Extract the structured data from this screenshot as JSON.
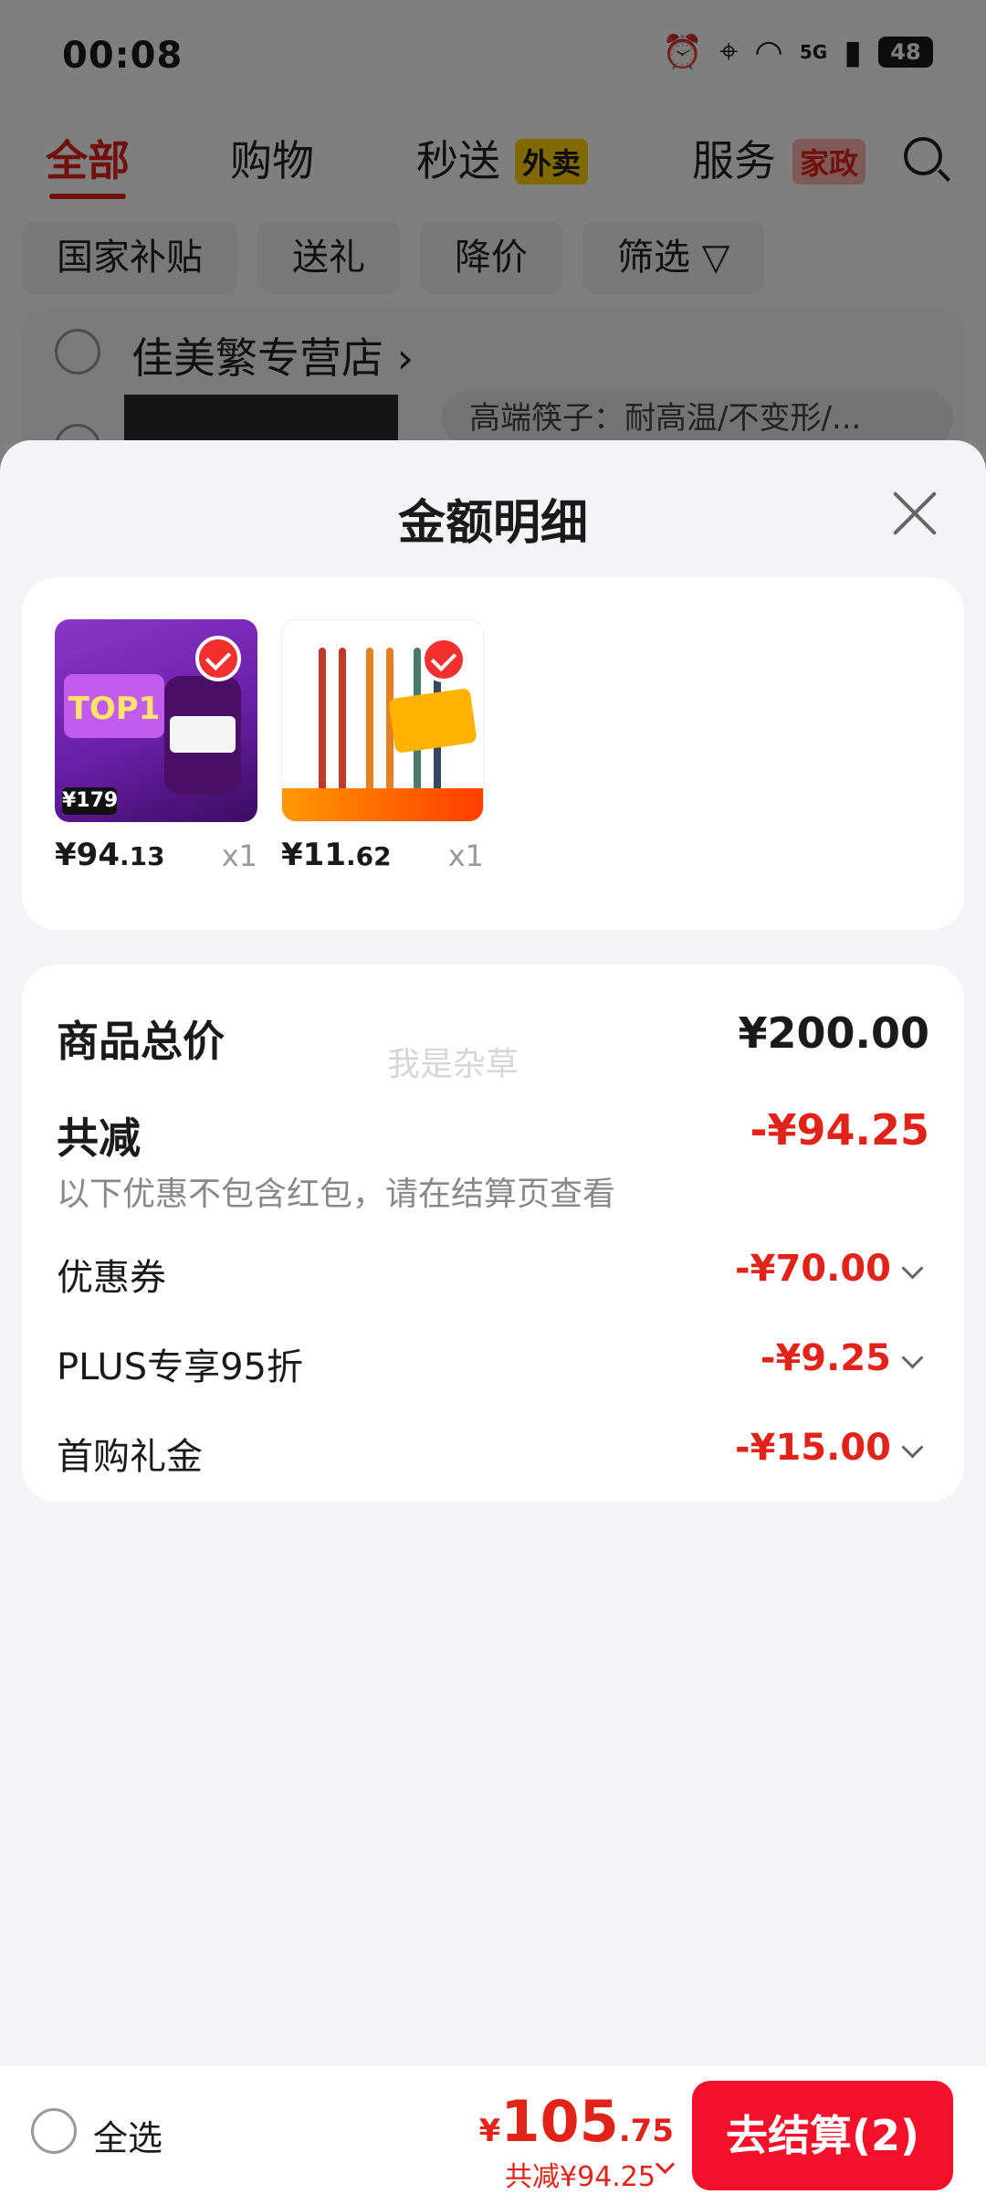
{
  "status_bar": {
    "time": "00:08",
    "network": "5G",
    "battery": "48"
  },
  "header": {
    "tabs": [
      {
        "label": "全部"
      },
      {
        "label": "购物"
      },
      {
        "label": "秒送",
        "badge": "外卖"
      },
      {
        "label": "服务",
        "badge": "家政"
      }
    ]
  },
  "filters": [
    "国家补贴",
    "送礼",
    "降价",
    "筛选"
  ],
  "store": {
    "name": "佳美繁专营店",
    "product_hint": "高端筷子：耐高温/不变形/..."
  },
  "sheet": {
    "title": "金额明细",
    "products": [
      {
        "price_int": "¥94",
        "price_dec": ".13",
        "qty": "x1",
        "img_text": "TOP1",
        "img_price": "¥179"
      },
      {
        "price_int": "¥11",
        "price_dec": ".62",
        "qty": "x1"
      }
    ],
    "summary": {
      "total_label": "商品总价",
      "total_value": "¥200.00",
      "watermark": "我是杂草",
      "reduce_label": "共减",
      "reduce_value": "-¥94.25",
      "note": "以下优惠不包含红包，请在结算页查看",
      "items": [
        {
          "label": "优惠券",
          "value": "-¥70.00"
        },
        {
          "label": "PLUS专享95折",
          "value": "-¥9.25"
        },
        {
          "label": "首购礼金",
          "value": "-¥15.00"
        }
      ]
    }
  },
  "bottom_bar": {
    "select_all": "全选",
    "total_yen": "¥",
    "total_int": "105",
    "total_dec": ".75",
    "discount": "共减¥94.25",
    "checkout": "去结算(2)"
  },
  "colors": {
    "accent": "#e2231a",
    "checkout_bg": "#f2102a",
    "sheet_bg": "#f4f4f6"
  }
}
